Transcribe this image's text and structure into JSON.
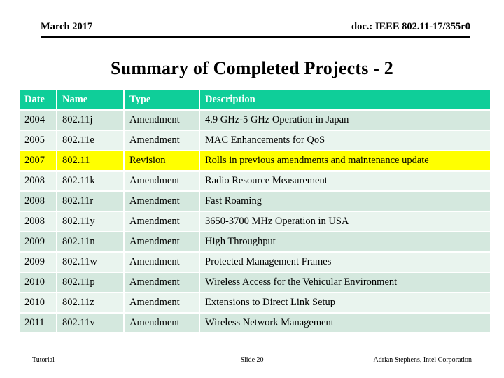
{
  "header": {
    "left": "March 2017",
    "right": "doc.: IEEE 802.11-17/355r0"
  },
  "title": "Summary of Completed Projects - 2",
  "colors": {
    "header_row_bg": "#0FCE99",
    "header_row_text": "#FFFFFF",
    "row_shade_bg": "#D4E8DE",
    "row_plain_bg": "#E9F4EE",
    "highlight_bg": "#FFFF00",
    "text": "#000000"
  },
  "table": {
    "columns": [
      "Date",
      "Name",
      "Type",
      "Description"
    ],
    "rows": [
      {
        "date": "2004",
        "name": "802.11j",
        "type": "Amendment",
        "description": "4.9 GHz-5 GHz Operation in Japan",
        "style": "shade"
      },
      {
        "date": "2005",
        "name": "802.11e",
        "type": "Amendment",
        "description": "MAC Enhancements for QoS",
        "style": "plain"
      },
      {
        "date": "2007",
        "name": "802.11",
        "type": "Revision",
        "description": "Rolls in previous amendments and maintenance update",
        "style": "highlight"
      },
      {
        "date": "2008",
        "name": "802.11k",
        "type": "Amendment",
        "description": "Radio Resource Measurement",
        "style": "plain"
      },
      {
        "date": "2008",
        "name": "802.11r",
        "type": "Amendment",
        "description": "Fast Roaming",
        "style": "shade"
      },
      {
        "date": "2008",
        "name": "802.11y",
        "type": "Amendment",
        "description": "3650-3700 MHz Operation in USA",
        "style": "plain"
      },
      {
        "date": "2009",
        "name": "802.11n",
        "type": "Amendment",
        "description": "High Throughput",
        "style": "shade"
      },
      {
        "date": "2009",
        "name": "802.11w",
        "type": "Amendment",
        "description": "Protected Management Frames",
        "style": "plain"
      },
      {
        "date": "2010",
        "name": "802.11p",
        "type": "Amendment",
        "description": "Wireless Access for the Vehicular Environment",
        "style": "shade"
      },
      {
        "date": "2010",
        "name": "802.11z",
        "type": "Amendment",
        "description": "Extensions to Direct Link Setup",
        "style": "plain"
      },
      {
        "date": "2011",
        "name": "802.11v",
        "type": "Amendment",
        "description": "Wireless Network Management",
        "style": "shade"
      }
    ]
  },
  "footer": {
    "left": "Tutorial",
    "center": "Slide 20",
    "right": "Adrian Stephens, Intel Corporation"
  }
}
